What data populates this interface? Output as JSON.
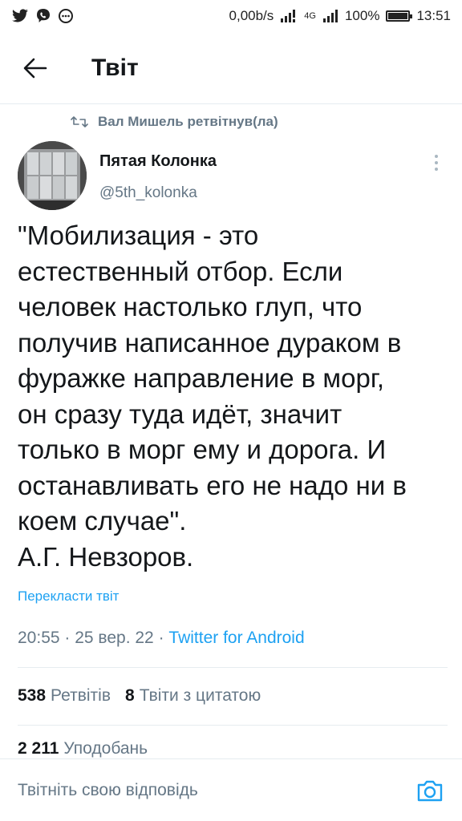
{
  "status_bar": {
    "data_rate": "0,00b/s",
    "network": "4G",
    "battery": "100%",
    "battery_level": 1.0,
    "time": "13:51"
  },
  "header": {
    "title": "Твіт"
  },
  "tweet": {
    "retweeted_by": "Вал Мишель ретвітнув(ла)",
    "author_name": "Пятая Колонка",
    "author_handle": "@5th_kolonka",
    "text": "\"Мобилизация - это\nестественный отбор. Если\nчеловек настолько глуп, что\nполучив написанное дураком в\nфуражке направление в морг,\nон сразу туда идёт, значит\nтолько в морг ему и дорога. И\nостанавливать его не надо ни в\nкоем случае\".\nА.Г. Невзоров.",
    "translate_label": "Перекласти твіт",
    "time": "20:55",
    "date": "25 вер. 22",
    "source": "Twitter for Android",
    "retweets_count": "538",
    "retweets_label": "Ретвітів",
    "quotes_count": "8",
    "quotes_label": "Твіти з цитатою",
    "likes_count": "2 211",
    "likes_label": "Уподобань"
  },
  "reply_bar": {
    "placeholder": "Твітніть свою відповідь"
  },
  "colors": {
    "accent": "#1da1f2",
    "secondary_text": "#657786",
    "primary_text": "#14171a",
    "divider": "#e6ecf0"
  },
  "icons": {
    "back": "arrow-left-icon",
    "retweet": "retweet-icon",
    "more": "more-vertical-icon",
    "camera": "camera-icon",
    "twitter": "twitter-bird-icon",
    "viber": "viber-icon",
    "messenger": "messenger-icon",
    "signal": "signal-bars-icon",
    "battery": "battery-icon"
  }
}
